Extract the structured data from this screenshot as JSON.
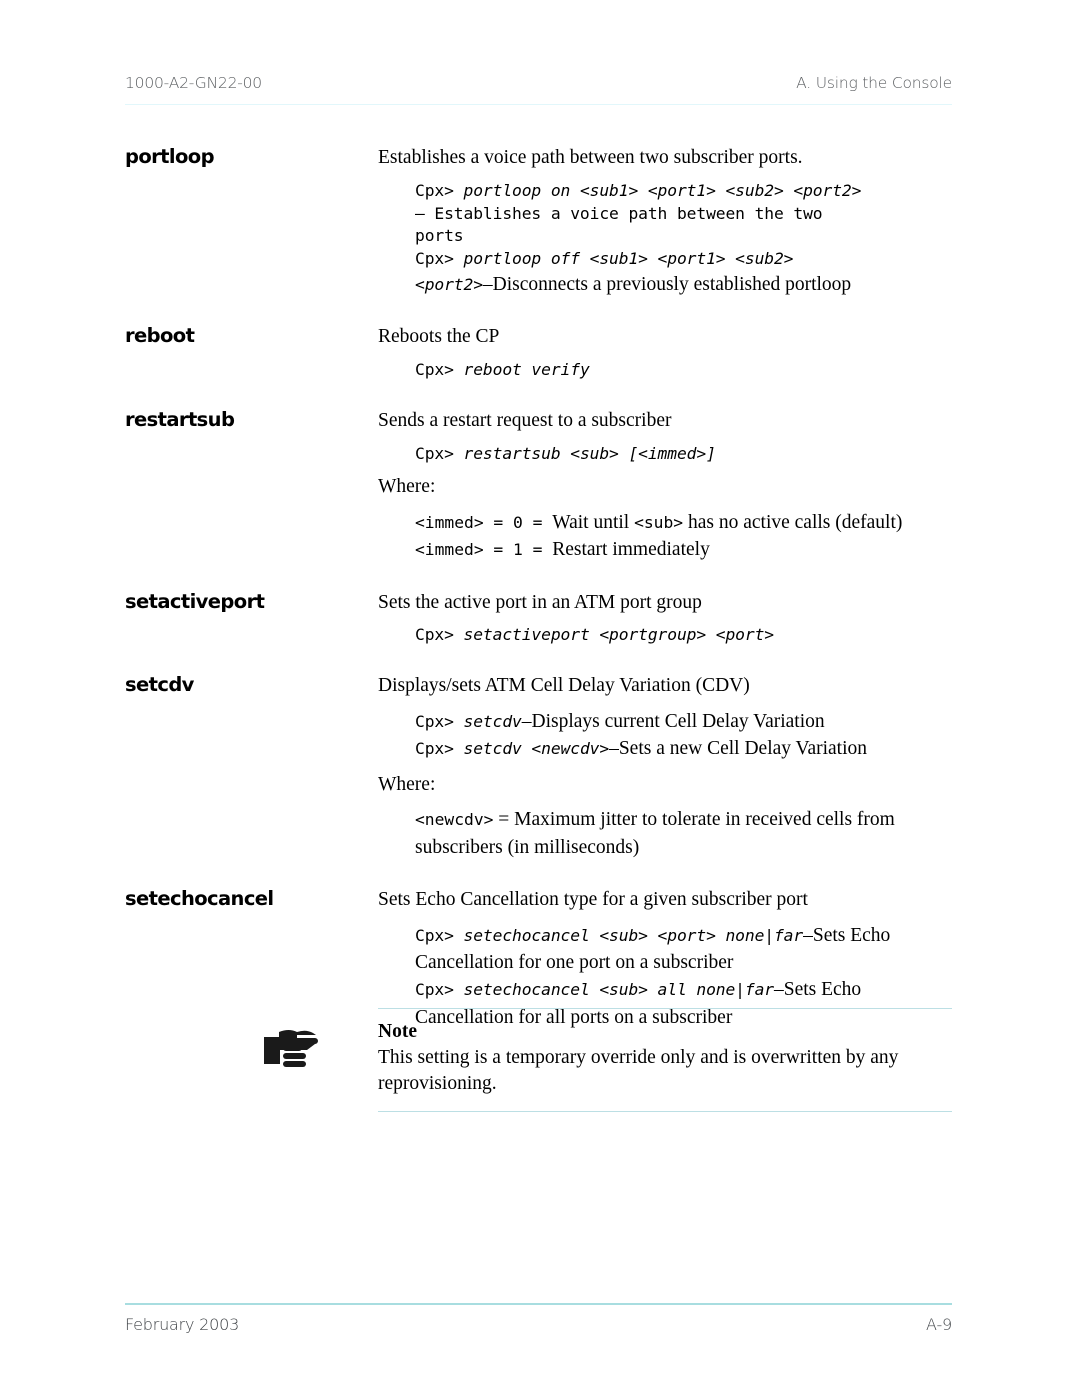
{
  "header": {
    "doc_number": "1000-A2-GN22-00",
    "section": "A. Using the Console"
  },
  "footer": {
    "date": "February 2003",
    "page": "A-9"
  },
  "entries": [
    {
      "term": "portloop",
      "description": "Establishes a voice path between two subscriber ports.",
      "examples": [
        {
          "prompt": "Cpx> ",
          "command": "portloop on <sub1> <port1> <sub2> <port2>"
        },
        {
          "mono_plain": "– Establishes a voice path between the two"
        },
        {
          "mono_plain": "ports"
        },
        {
          "prompt": "Cpx> ",
          "command": "portloop off <sub1> <port1> <sub2>"
        },
        {
          "command": "<port2>",
          "serif_tail": "–Disconnects a previously established portloop"
        }
      ]
    },
    {
      "term": "reboot",
      "description": "Reboots the CP",
      "examples": [
        {
          "prompt": "Cpx> ",
          "command": "reboot verify"
        }
      ]
    },
    {
      "term": "restartsub",
      "description": "Sends a restart request to a subscriber",
      "examples": [
        {
          "prompt": "Cpx> ",
          "command": "restartsub <sub> [<immed>]"
        }
      ],
      "where_label": "Where:",
      "definitions": [
        {
          "key": "<immed> = 0 = ",
          "text": "Wait until ",
          "key2": "<sub>",
          "text2": " has no active calls (default)"
        },
        {
          "key": "<immed> = 1 = ",
          "text": "Restart immediately"
        }
      ]
    },
    {
      "term": "setactiveport",
      "description": "Sets the active port in an ATM port group",
      "examples": [
        {
          "prompt": "Cpx> ",
          "command": "setactiveport <portgroup> <port>"
        }
      ]
    },
    {
      "term": "setcdv",
      "description": "Displays/sets ATM Cell Delay Variation (CDV)",
      "examples": [
        {
          "prompt": "Cpx> ",
          "command": "setcdv",
          "serif_tail": "–Displays current Cell Delay Variation"
        },
        {
          "prompt": "Cpx> ",
          "command": "setcdv <newcdv>",
          "serif_tail": "–Sets a new Cell Delay Variation"
        }
      ],
      "where_label": "Where:",
      "definitions": [
        {
          "key": "<newcdv>",
          "text": " = Maximum jitter to tolerate in received cells from subscribers (in milliseconds)"
        }
      ]
    },
    {
      "term": "setechocancel",
      "description": "Sets Echo Cancellation type for a given subscriber port",
      "examples": [
        {
          "prompt": "Cpx> ",
          "command": "setechocancel <sub> <port> none|far",
          "serif_tail": "–Sets Echo"
        },
        {
          "serif_only": "Cancellation for one port on a subscriber"
        },
        {
          "prompt": "Cpx> ",
          "command": "setechocancel <sub> all none|far",
          "serif_tail": "–Sets Echo"
        },
        {
          "serif_only": "Cancellation for all ports on a subscriber"
        }
      ]
    }
  ],
  "note": {
    "icon": "pointing-hand-icon",
    "title": "Note",
    "text": "This setting is a temporary override only and is overwritten by any reprovisioning."
  }
}
